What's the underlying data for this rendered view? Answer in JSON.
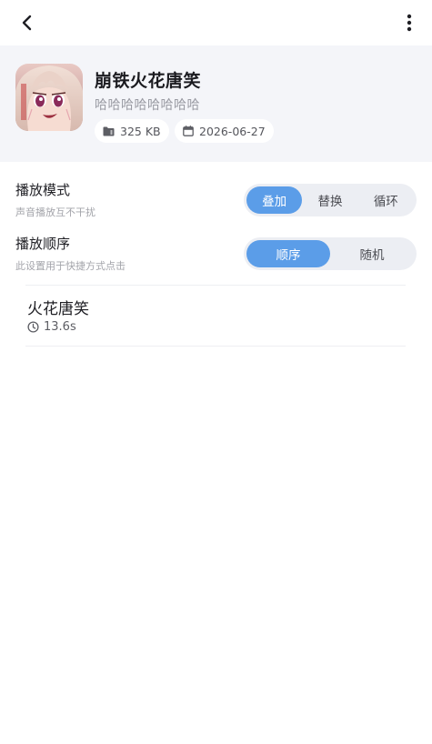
{
  "topbar": {
    "back_icon": "chevron-left-icon",
    "more_icon": "more-vertical-icon"
  },
  "pack": {
    "title": "崩铁火花唐笑",
    "subtitle": "哈哈哈哈哈哈哈哈",
    "size": "325 KB",
    "date": "2026-06-27",
    "size_icon": "folder-icon",
    "date_icon": "calendar-icon",
    "cover_icon": "anime-avatar-image"
  },
  "settings": {
    "play_mode": {
      "title": "播放模式",
      "desc": "声音播放互不干扰",
      "options": [
        "叠加",
        "替换",
        "循环"
      ],
      "selected": "叠加"
    },
    "play_order": {
      "title": "播放顺序",
      "desc": "此设置用于快捷方式点击",
      "options": [
        "顺序",
        "随机"
      ],
      "selected": "顺序"
    }
  },
  "sounds": [
    {
      "name": "火花唐笑",
      "duration": "13.6s",
      "icon": "clock-icon"
    }
  ],
  "colors": {
    "accent": "#5b9de8",
    "header_bg": "#f4f5f9",
    "segment_bg": "#eceef3"
  }
}
